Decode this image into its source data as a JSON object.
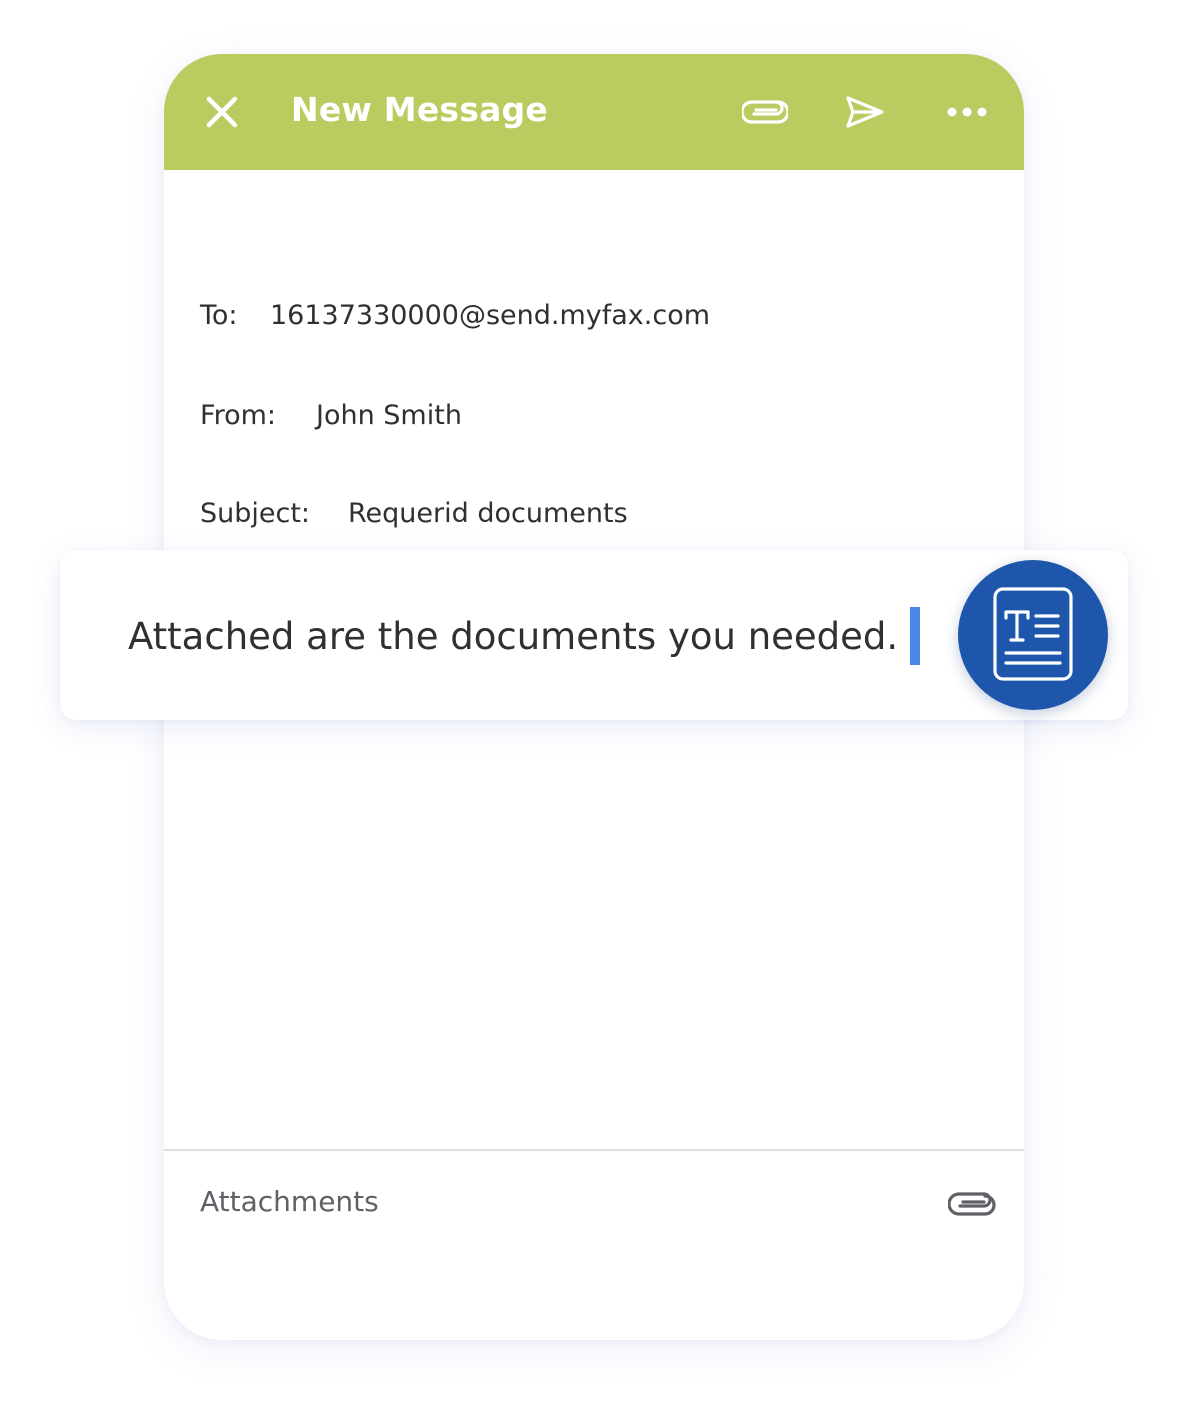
{
  "header": {
    "title": "New Message",
    "background_color": "#b9cc5f",
    "icons": [
      "close-icon",
      "paperclip-icon",
      "send-icon",
      "more-icon"
    ]
  },
  "fields": {
    "to_label": "To:",
    "to_value": "16137330000@send.myfax.com",
    "from_label": "From:",
    "from_value": "John Smith",
    "subject_label": "Subject:",
    "subject_value": "Requerid documents"
  },
  "body": {
    "text": "Attached are the documents you needed.",
    "caret_color": "#4a86e8",
    "badge_icon": "text-document-icon",
    "badge_color": "#1d56ab"
  },
  "footer": {
    "attachments_label": "Attachments",
    "attach_icon": "paperclip-icon"
  }
}
